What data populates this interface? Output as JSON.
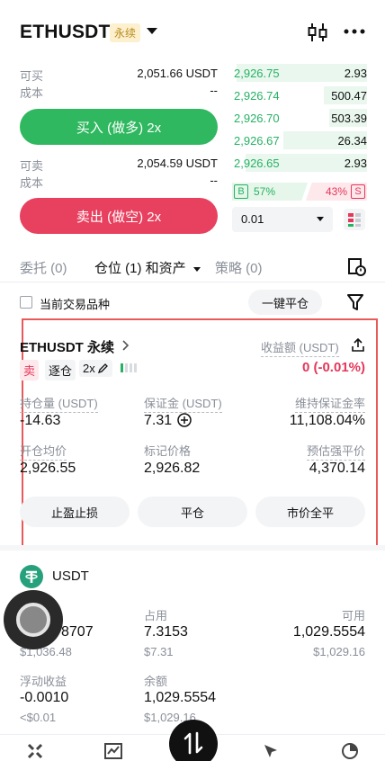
{
  "header": {
    "pair": "ETHUSDT",
    "tag": "永续"
  },
  "trade": {
    "can_buy_label": "可买",
    "can_buy_value": "2,051.66 USDT",
    "cost_label": "成本",
    "cost_value": "--",
    "buy_button": "买入 (做多) 2x",
    "can_sell_label": "可卖",
    "can_sell_value": "2,054.59 USDT",
    "cost2_label": "成本",
    "cost2_value": "--",
    "sell_button": "卖出 (做空) 2x"
  },
  "orderbook": {
    "rows": [
      {
        "price": "2,926.75",
        "qty": "2.93"
      },
      {
        "price": "2,926.74",
        "qty": "500.47"
      },
      {
        "price": "2,926.70",
        "qty": "503.39"
      },
      {
        "price": "2,926.67",
        "qty": "26.34"
      },
      {
        "price": "2,926.65",
        "qty": "2.93"
      }
    ],
    "depth_fill": [
      0.97,
      0.32,
      0.28,
      0.62,
      0.9
    ],
    "buy_tag": "B",
    "buy_pct": "57%",
    "sell_pct": "43%",
    "sell_tag": "S",
    "depth": "0.01"
  },
  "tabs": {
    "orders": "委托 (0)",
    "positions": "仓位 (1) 和资产",
    "strategy": "策略 (0)"
  },
  "filter": {
    "current_only": "当前交易品种",
    "close_all": "一键平仓"
  },
  "position": {
    "name": "ETHUSDT 永续",
    "pnl_label": "收益额 (USDT)",
    "side": "卖",
    "margin_mode": "逐仓",
    "leverage": "2x",
    "pnl_value": "0 (-0.01%)",
    "size_label": "持仓量 (USDT)",
    "size_value": "-14.63",
    "margin_label": "保证金 (USDT)",
    "margin_value": "7.31",
    "mmr_label": "维持保证金率",
    "mmr_value": "11,108.04%",
    "entry_label": "开仓均价",
    "entry_value": "2,926.55",
    "mark_label": "标记价格",
    "mark_value": "2,926.82",
    "liq_label": "预估强平价",
    "liq_value": "4,370.14",
    "btn_tpsl": "止盈止损",
    "btn_close": "平仓",
    "btn_market_close": "市价全平"
  },
  "assets": {
    "coin": "USDT",
    "equity_value": "8707",
    "equity_usd": "$1,036.48",
    "used_label": "占用",
    "used_value": "7.3153",
    "used_usd": "$7.31",
    "avail_label": "可用",
    "avail_value": "1,029.5554",
    "avail_usd": "$1,029.16",
    "upnl_label": "浮动收益",
    "upnl_value": "-0.0010",
    "upnl_usd": "<$0.01",
    "balance_label": "余额",
    "balance_value": "1,029.5554",
    "balance_usd": "$1,029.16"
  },
  "colors": {
    "buy": "#2fb85f",
    "sell": "#e8405f",
    "highlight": "#e85a5a"
  }
}
